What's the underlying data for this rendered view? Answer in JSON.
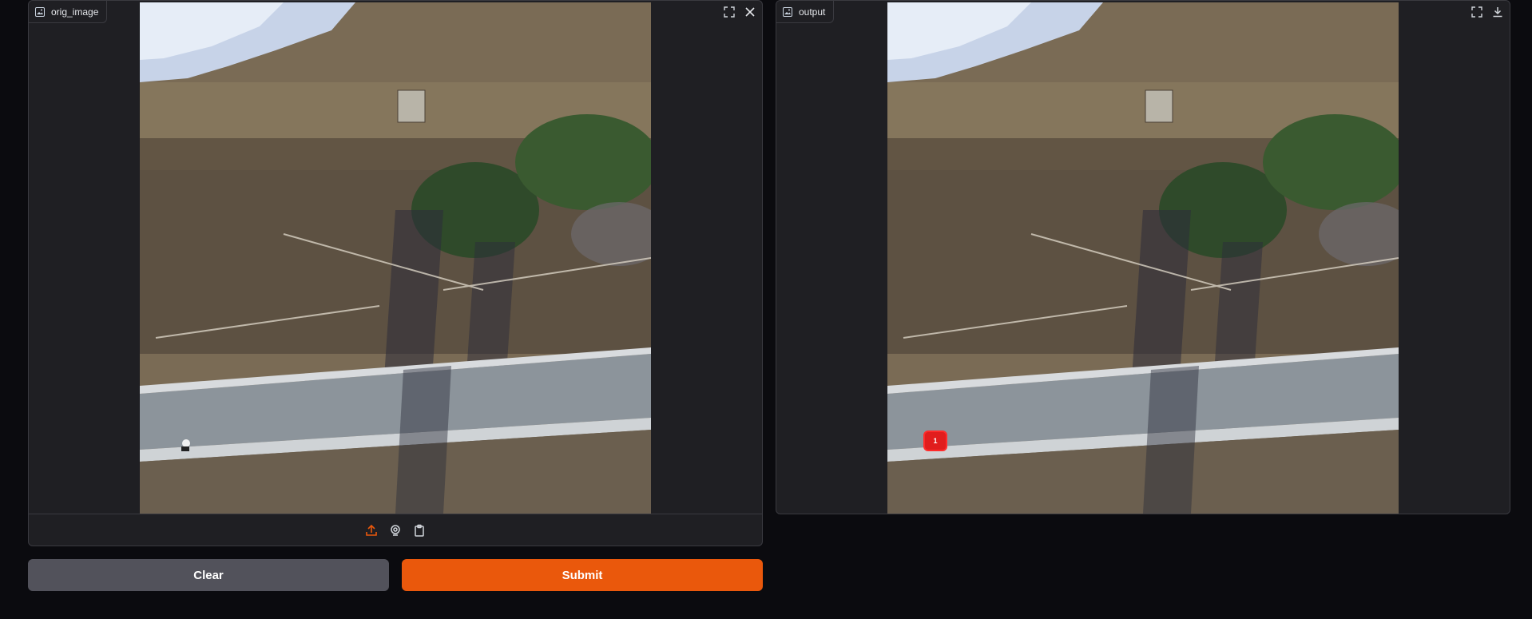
{
  "input_panel": {
    "label": "orig_image",
    "label_icon": "image-icon",
    "actions": [
      "fullscreen-icon",
      "close-icon"
    ],
    "toolbar": [
      "upload-icon",
      "webcam-icon",
      "clipboard-icon"
    ]
  },
  "output_panel": {
    "label": "output",
    "label_icon": "image-icon",
    "actions": [
      "fullscreen-icon",
      "download-icon"
    ],
    "detection_label": "1"
  },
  "buttons": {
    "clear": "Clear",
    "submit": "Submit"
  },
  "colors": {
    "background": "#0b0b0f",
    "panel": "#1f1f23",
    "accent": "#ea580c",
    "secondary": "#52525b",
    "detection": "#e11d1d"
  }
}
